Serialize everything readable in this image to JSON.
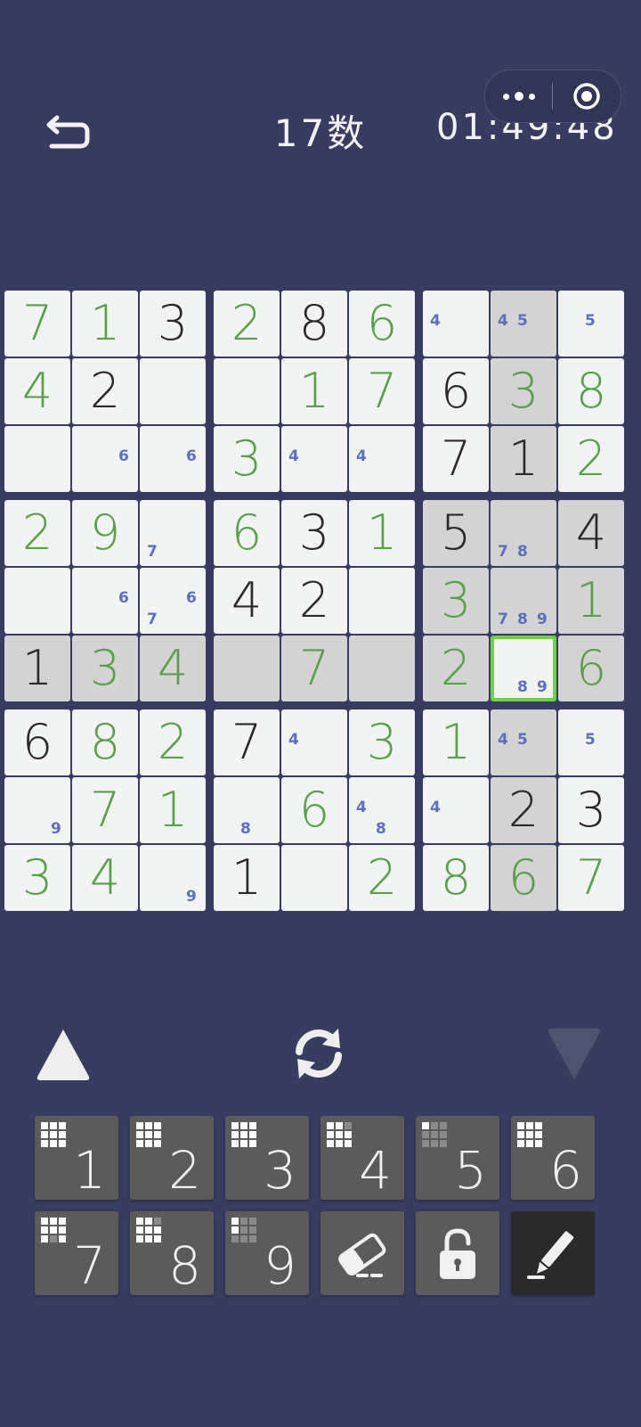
{
  "header": {
    "title": "17数",
    "timer": "01:49:48"
  },
  "board": {
    "cells": [
      [
        {
          "v": "7",
          "t": "user"
        },
        {
          "v": "1",
          "t": "user"
        },
        {
          "v": "3",
          "t": "given"
        },
        {
          "v": "2",
          "t": "user"
        },
        {
          "v": "8",
          "t": "given"
        },
        {
          "v": "6",
          "t": "user"
        },
        {
          "n": [
            "4"
          ]
        },
        {
          "n": [
            "4",
            "5"
          ],
          "hl": true
        },
        {
          "n": [
            "5"
          ]
        }
      ],
      [
        {
          "v": "4",
          "t": "user"
        },
        {
          "v": "2",
          "t": "given"
        },
        {},
        {},
        {
          "v": "1",
          "t": "user"
        },
        {
          "v": "7",
          "t": "user"
        },
        {
          "v": "6",
          "t": "given"
        },
        {
          "v": "3",
          "t": "user",
          "hl": true
        },
        {
          "v": "8",
          "t": "user"
        }
      ],
      [
        {},
        {
          "n": [
            "6"
          ]
        },
        {
          "n": [
            "6"
          ]
        },
        {
          "v": "3",
          "t": "user"
        },
        {
          "n": [
            "4"
          ]
        },
        {
          "n": [
            "4"
          ]
        },
        {
          "v": "7",
          "t": "given"
        },
        {
          "v": "1",
          "t": "given",
          "hl": true
        },
        {
          "v": "2",
          "t": "user"
        }
      ],
      [
        {
          "v": "2",
          "t": "user"
        },
        {
          "v": "9",
          "t": "user"
        },
        {
          "n": [
            "7"
          ]
        },
        {
          "v": "6",
          "t": "user"
        },
        {
          "v": "3",
          "t": "given"
        },
        {
          "v": "1",
          "t": "user"
        },
        {
          "v": "5",
          "t": "given",
          "hl": true
        },
        {
          "n": [
            "7",
            "8"
          ],
          "hl": true
        },
        {
          "v": "4",
          "t": "given",
          "hl": true
        }
      ],
      [
        {},
        {
          "n": [
            "6"
          ]
        },
        {
          "n": [
            "6",
            "7"
          ]
        },
        {
          "v": "4",
          "t": "given"
        },
        {
          "v": "2",
          "t": "given"
        },
        {},
        {
          "v": "3",
          "t": "user",
          "hl": true
        },
        {
          "n": [
            "7",
            "8",
            "9"
          ],
          "hl": true
        },
        {
          "v": "1",
          "t": "user",
          "hl": true
        }
      ],
      [
        {
          "v": "1",
          "t": "given",
          "hl": true
        },
        {
          "v": "3",
          "t": "user",
          "hl": true
        },
        {
          "v": "4",
          "t": "user",
          "hl": true
        },
        {
          "hl": true
        },
        {
          "v": "7",
          "t": "user",
          "hl": true
        },
        {
          "hl": true
        },
        {
          "v": "2",
          "t": "user",
          "hl": true
        },
        {
          "n": [
            "8",
            "9"
          ],
          "sel": true
        },
        {
          "v": "6",
          "t": "user",
          "hl": true
        }
      ],
      [
        {
          "v": "6",
          "t": "given"
        },
        {
          "v": "8",
          "t": "user"
        },
        {
          "v": "2",
          "t": "user"
        },
        {
          "v": "7",
          "t": "given"
        },
        {
          "n": [
            "4"
          ]
        },
        {
          "v": "3",
          "t": "user"
        },
        {
          "v": "1",
          "t": "user"
        },
        {
          "n": [
            "4",
            "5"
          ],
          "hl": true
        },
        {
          "n": [
            "5"
          ]
        }
      ],
      [
        {
          "n": [
            "9"
          ]
        },
        {
          "v": "7",
          "t": "user"
        },
        {
          "v": "1",
          "t": "user"
        },
        {
          "n": [
            "8"
          ]
        },
        {
          "v": "6",
          "t": "user"
        },
        {
          "n": [
            "4",
            "8"
          ]
        },
        {
          "n": [
            "4"
          ]
        },
        {
          "v": "2",
          "t": "given",
          "hl": true
        },
        {
          "v": "3",
          "t": "given"
        }
      ],
      [
        {
          "v": "3",
          "t": "user"
        },
        {
          "v": "4",
          "t": "user"
        },
        {
          "n": [
            "9"
          ]
        },
        {
          "v": "1",
          "t": "given"
        },
        {},
        {
          "v": "2",
          "t": "user"
        },
        {
          "v": "8",
          "t": "user"
        },
        {
          "v": "6",
          "t": "user",
          "hl": true
        },
        {
          "v": "7",
          "t": "user"
        }
      ]
    ]
  },
  "controls": {
    "prev": "triangle-up-icon",
    "refresh": "refresh-icon",
    "next": "triangle-down-icon"
  },
  "numpad": {
    "keys": [
      {
        "digit": "1",
        "placed": [
          1,
          1,
          1,
          1,
          1,
          1,
          1,
          1,
          1
        ]
      },
      {
        "digit": "2",
        "placed": [
          1,
          1,
          1,
          1,
          1,
          1,
          1,
          1,
          1
        ]
      },
      {
        "digit": "3",
        "placed": [
          1,
          1,
          1,
          1,
          1,
          1,
          1,
          1,
          1
        ]
      },
      {
        "digit": "4",
        "placed": [
          1,
          1,
          0,
          1,
          1,
          1,
          1,
          1,
          1
        ]
      },
      {
        "digit": "5",
        "placed": [
          1,
          0,
          0,
          0,
          0,
          0,
          0,
          0,
          0
        ]
      },
      {
        "digit": "6",
        "placed": [
          1,
          1,
          1,
          1,
          1,
          1,
          1,
          1,
          1
        ]
      },
      {
        "digit": "7",
        "placed": [
          1,
          1,
          1,
          1,
          1,
          1,
          1,
          0,
          1
        ]
      },
      {
        "digit": "8",
        "placed": [
          1,
          1,
          0,
          1,
          1,
          1,
          1,
          1,
          1
        ]
      },
      {
        "digit": "9",
        "placed": [
          1,
          0,
          0,
          1,
          0,
          0,
          0,
          0,
          0
        ]
      }
    ],
    "tools": [
      "eraser-icon",
      "lock-icon",
      "pencil-icon"
    ]
  },
  "colors": {
    "background": "#363d60",
    "user_digit": "#5b9e4b",
    "given_digit": "#2a2a2a",
    "note": "#5e6fc2",
    "selected_border": "#6fd04f"
  }
}
